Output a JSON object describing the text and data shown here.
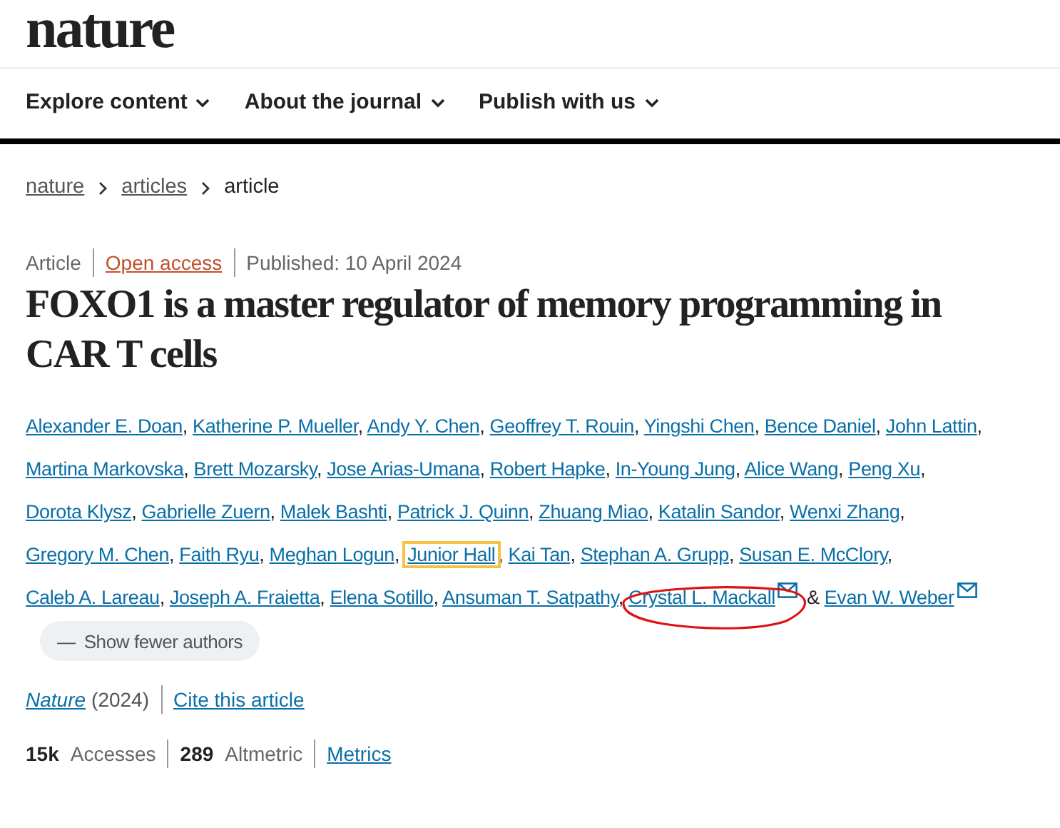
{
  "logo": "nature",
  "nav": [
    {
      "label": "Explore content"
    },
    {
      "label": "About the journal"
    },
    {
      "label": "Publish with us"
    }
  ],
  "breadcrumb": [
    {
      "label": "nature",
      "link": true
    },
    {
      "label": "articles",
      "link": true
    },
    {
      "label": "article",
      "link": false
    }
  ],
  "meta": {
    "type": "Article",
    "access": "Open access",
    "published": "Published: 10 April 2024"
  },
  "title": "FOXO1 is a master regulator of memory programming in CAR T cells",
  "authors": [
    {
      "name": "Alexander E. Doan",
      "after": ","
    },
    {
      "name": "Katherine P. Mueller",
      "after": ","
    },
    {
      "name": "Andy Y. Chen",
      "after": ","
    },
    {
      "name": "Geoffrey T. Rouin",
      "after": ","
    },
    {
      "name": "Yingshi Chen",
      "after": ","
    },
    {
      "name": "Bence Daniel",
      "after": ","
    },
    {
      "name": "John Lattin",
      "after": ","
    },
    {
      "name": "Martina Markovska",
      "after": ","
    },
    {
      "name": "Brett Mozarsky",
      "after": ","
    },
    {
      "name": "Jose Arias-Umana",
      "after": ","
    },
    {
      "name": "Robert Hapke",
      "after": ","
    },
    {
      "name": "In-Young Jung",
      "after": ","
    },
    {
      "name": "Alice Wang",
      "after": ","
    },
    {
      "name": "Peng Xu",
      "after": ","
    },
    {
      "name": "Dorota Klysz",
      "after": ","
    },
    {
      "name": "Gabrielle Zuern",
      "after": ","
    },
    {
      "name": "Malek Bashti",
      "after": ","
    },
    {
      "name": "Patrick J. Quinn",
      "after": ","
    },
    {
      "name": "Zhuang Miao",
      "after": ","
    },
    {
      "name": "Katalin Sandor",
      "after": ","
    },
    {
      "name": "Wenxi Zhang",
      "after": ","
    },
    {
      "name": "Gregory M. Chen",
      "after": ","
    },
    {
      "name": "Faith Ryu",
      "after": ","
    },
    {
      "name": "Meghan Logun",
      "after": ","
    },
    {
      "name": "Junior Hall",
      "after": ",",
      "focused": true
    },
    {
      "name": "Kai Tan",
      "after": ","
    },
    {
      "name": "Stephan A. Grupp",
      "after": ","
    },
    {
      "name": "Susan E. McClory",
      "after": ","
    },
    {
      "name": "Caleb A. Lareau",
      "after": ","
    },
    {
      "name": "Joseph A. Fraietta",
      "after": ","
    },
    {
      "name": "Elena Sotillo",
      "after": ","
    },
    {
      "name": "Ansuman T. Satpathy",
      "after": ","
    },
    {
      "name": "Crystal L. Mackall",
      "after": "&",
      "email": true,
      "circled": true
    },
    {
      "name": "Evan W. Weber",
      "email": true
    }
  ],
  "show_fewer": {
    "symbol": "—",
    "label": "Show fewer authors"
  },
  "citation": {
    "journal": "Nature",
    "year": "(2024)",
    "cite": "Cite this article"
  },
  "metrics": [
    {
      "count": "15k",
      "name": "Accesses"
    },
    {
      "count": "289",
      "name": "Altmetric"
    }
  ],
  "metrics_link": "Metrics"
}
